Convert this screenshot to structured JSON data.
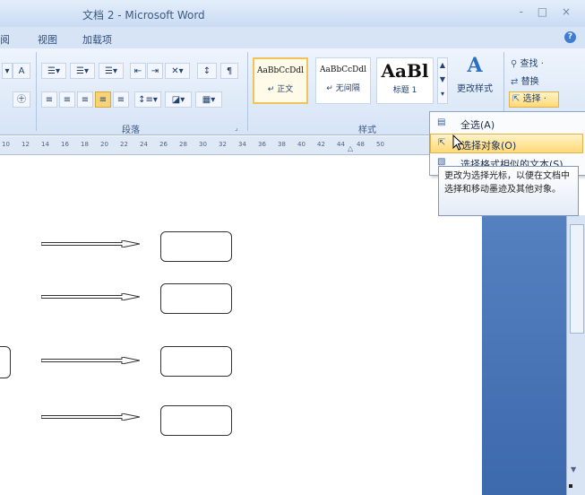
{
  "window": {
    "title": "文档 2 - Microsoft Word",
    "controls": "- □ ×"
  },
  "tabs": [
    {
      "label": "阅"
    },
    {
      "label": "视图"
    },
    {
      "label": "加载项"
    }
  ],
  "ribbon": {
    "paragraph_group_label": "段落",
    "styles_group_label": "样式",
    "styles": [
      {
        "sample": "AaBbCcDdl",
        "name": "↵ 正文",
        "selected": true
      },
      {
        "sample": "AaBbCcDdl",
        "name": "↵ 无间隔",
        "selected": false
      },
      {
        "sample": "AaBl",
        "name": "标题 1",
        "selected": false
      }
    ],
    "change_styles_label": "更改样式",
    "find_label": "查找 ·",
    "replace_label": "替换",
    "select_label": "选择 ·"
  },
  "ruler_ticks": [
    "10",
    "12",
    "14",
    "16",
    "18",
    "20",
    "22",
    "24",
    "26",
    "28",
    "30",
    "32",
    "34",
    "36",
    "38",
    "40",
    "42",
    "44",
    "48",
    "50"
  ],
  "menu": {
    "items": [
      {
        "label": "全选(A)",
        "icon": "select-all-icon"
      },
      {
        "label": "选择对象(O)",
        "icon": "cursor-arrow-icon",
        "highlighted": true
      },
      {
        "label": "选择格式相似的文本(S)",
        "icon": "format-icon"
      }
    ]
  },
  "tooltip": {
    "text": "更改为选择光标，以便在文档中选择和移动墨迹及其他对象。"
  }
}
